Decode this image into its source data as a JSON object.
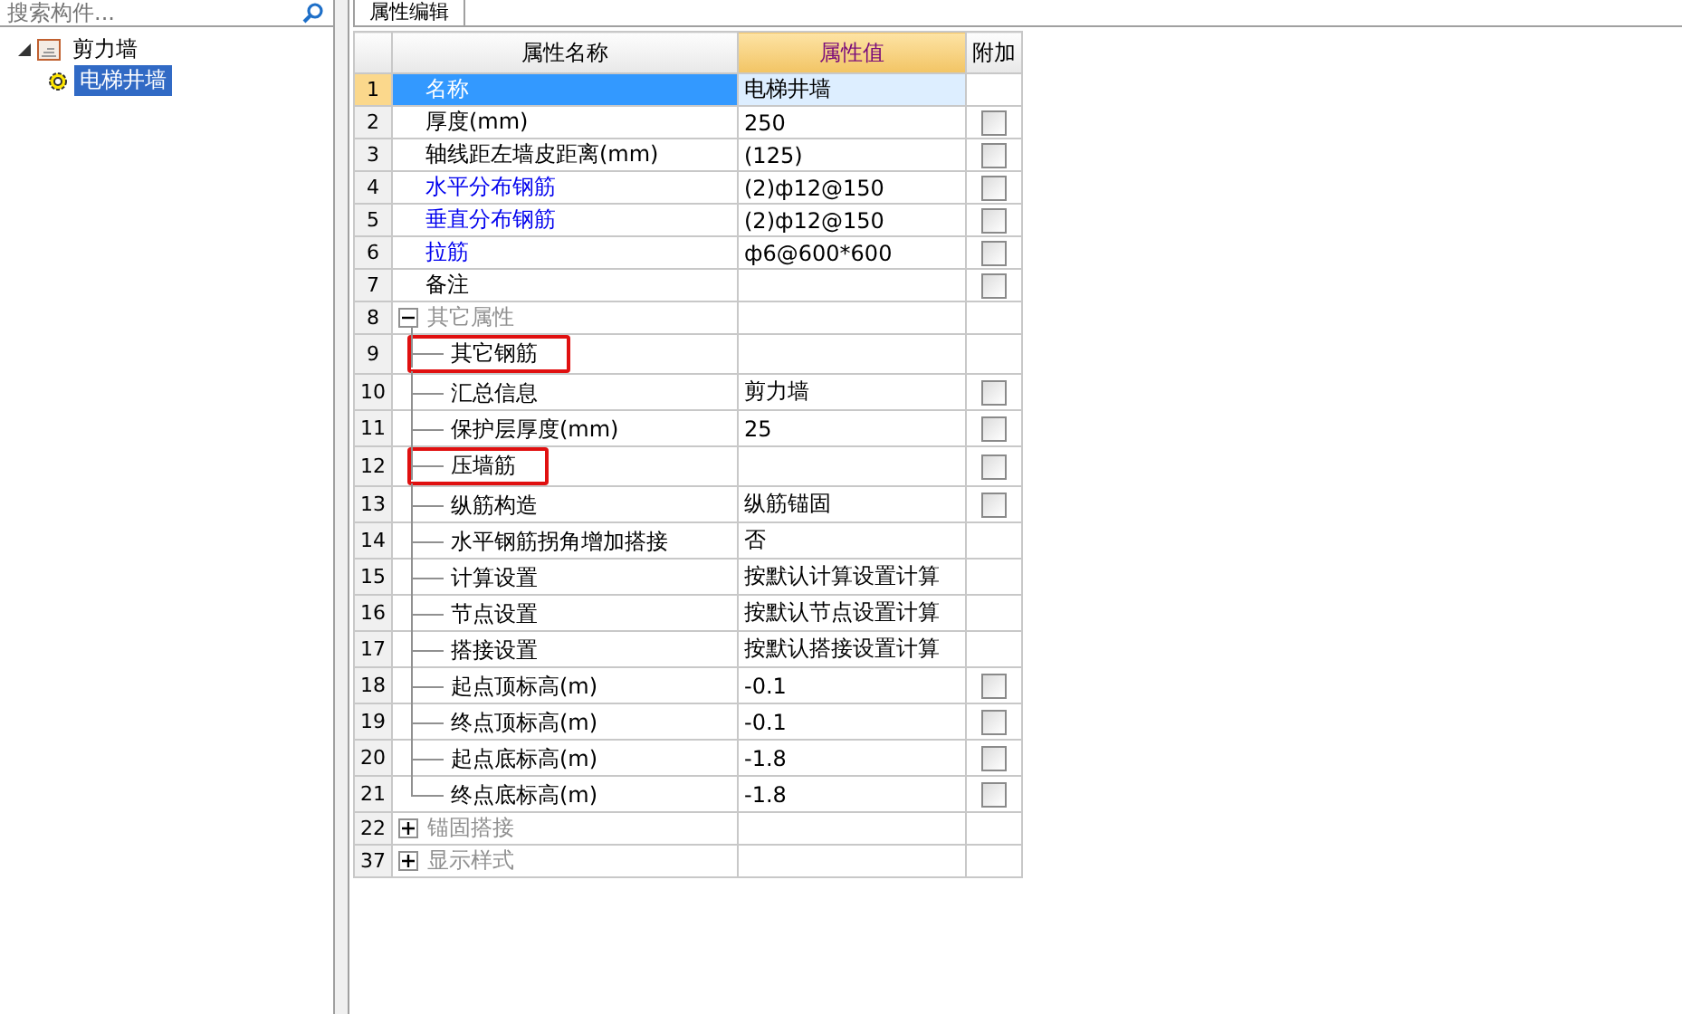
{
  "search": {
    "placeholder": "搜索构件..."
  },
  "tree": [
    {
      "label": "剪力墙",
      "expanded": true,
      "selected": false,
      "children": [
        {
          "label": "电梯井墙",
          "selected": true
        }
      ]
    }
  ],
  "tab": {
    "label": "属性编辑"
  },
  "grid": {
    "columns": [
      "属性名称",
      "属性值",
      "附加"
    ],
    "rows": [
      {
        "num": "1",
        "name": "名称",
        "value": "电梯井墙",
        "selected": true,
        "link": false
      },
      {
        "num": "2",
        "name": "厚度(mm)",
        "value": "250",
        "selected": false,
        "link": false,
        "checked": false
      },
      {
        "num": "3",
        "name": "轴线距左墙皮距离(mm)",
        "value": "(125)",
        "selected": false,
        "link": false,
        "checked": false
      },
      {
        "num": "4",
        "name": "水平分布钢筋",
        "value": "(2)ф12@150",
        "selected": false,
        "link": true,
        "checked": false
      },
      {
        "num": "5",
        "name": "垂直分布钢筋",
        "value": "(2)ф12@150",
        "selected": false,
        "link": true,
        "checked": false
      },
      {
        "num": "6",
        "name": "拉筋",
        "value": "ф6@600*600",
        "selected": false,
        "link": true,
        "checked": false
      },
      {
        "num": "7",
        "name": "备注",
        "selected": false,
        "link": false,
        "checked": false
      },
      {
        "num": "8",
        "name": "其它属性",
        "selected": false,
        "expanded": true,
        "children": [
          {
            "num": "9",
            "name": "其它钢筋",
            "selected": false,
            "marked": true
          },
          {
            "num": "10",
            "name": "汇总信息",
            "value": "剪力墙",
            "selected": false,
            "marked": false,
            "checked": false
          },
          {
            "num": "11",
            "name": "保护层厚度(mm)",
            "value": "25",
            "selected": false,
            "marked": false,
            "checked": false
          },
          {
            "num": "12",
            "name": "压墙筋",
            "selected": false,
            "marked": true,
            "checked": false
          },
          {
            "num": "13",
            "name": "纵筋构造",
            "value": "纵筋锚固",
            "selected": false,
            "marked": false,
            "checked": false
          },
          {
            "num": "14",
            "name": "水平钢筋拐角增加搭接",
            "value": "否",
            "selected": false,
            "marked": false
          },
          {
            "num": "15",
            "name": "计算设置",
            "value": "按默认计算设置计算",
            "selected": false,
            "marked": false
          },
          {
            "num": "16",
            "name": "节点设置",
            "value": "按默认节点设置计算",
            "selected": false,
            "marked": false
          },
          {
            "num": "17",
            "name": "搭接设置",
            "value": "按默认搭接设置计算",
            "selected": false,
            "marked": false
          },
          {
            "num": "18",
            "name": "起点顶标高(m)",
            "value": "-0.1",
            "selected": false,
            "marked": false,
            "checked": false
          },
          {
            "num": "19",
            "name": "终点顶标高(m)",
            "value": "-0.1",
            "selected": false,
            "marked": false,
            "checked": false
          },
          {
            "num": "20",
            "name": "起点底标高(m)",
            "value": "-1.8",
            "selected": false,
            "marked": false,
            "checked": false
          },
          {
            "num": "21",
            "name": "终点底标高(m)",
            "value": "-1.8",
            "selected": false,
            "marked": false,
            "checked": false
          }
        ]
      },
      {
        "num": "22",
        "name": "锚固搭接",
        "selected": false,
        "expanded": false,
        "children": []
      },
      {
        "num": "37",
        "name": "显示样式",
        "selected": false,
        "expanded": false,
        "children": []
      }
    ]
  }
}
